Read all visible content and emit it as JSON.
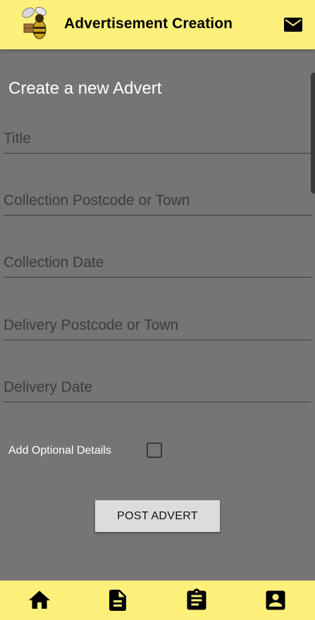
{
  "header": {
    "title": "Advertisement Creation",
    "logo_icon": "bee-logo-icon",
    "mail_icon": "mail-icon",
    "background": "#fdf07a"
  },
  "form": {
    "heading": "Create a new Advert",
    "fields": [
      {
        "label": "Title"
      },
      {
        "label": "Collection Postcode or Town"
      },
      {
        "label": "Collection Date"
      },
      {
        "label": "Delivery Postcode or Town"
      },
      {
        "label": "Delivery Date"
      }
    ],
    "optional_details_label": "Add Optional Details",
    "optional_details_checked": false,
    "submit_label": "POST ADVERT"
  },
  "bottom_nav": {
    "items": [
      {
        "icon": "home-icon"
      },
      {
        "icon": "document-icon"
      },
      {
        "icon": "clipboard-icon"
      },
      {
        "icon": "account-box-icon"
      }
    ]
  },
  "colors": {
    "background": "#757575",
    "accent": "#fdf07a"
  }
}
